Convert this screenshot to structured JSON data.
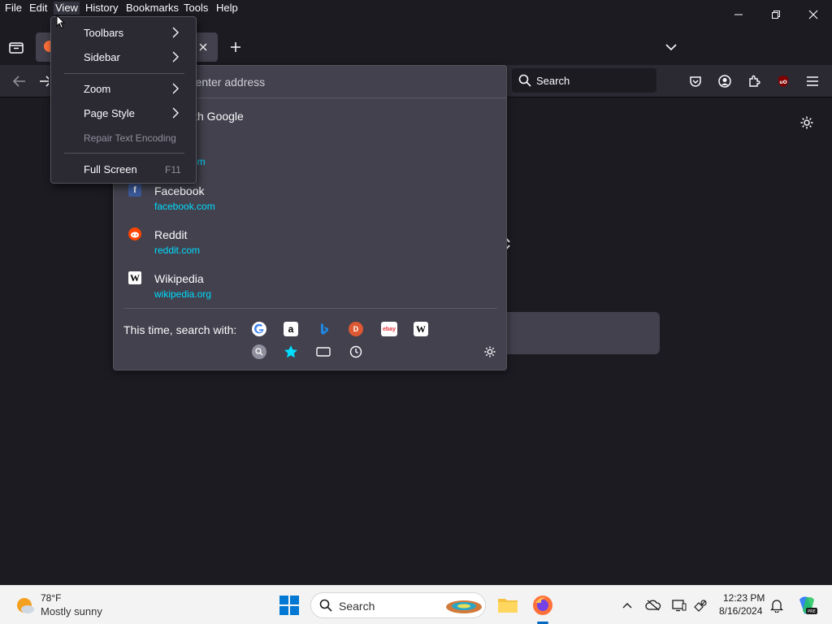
{
  "menubar": {
    "items": [
      "File",
      "Edit",
      "View",
      "History",
      "Bookmarks",
      "Tools",
      "Help"
    ]
  },
  "navbar": {
    "search_placeholder": "Search"
  },
  "urlbar": {
    "placeholder": "r enter address",
    "search_with_text": "ith Google",
    "partial_url": "om",
    "results": [
      {
        "title": "Facebook",
        "url": "facebook.com",
        "icon": "facebook-icon"
      },
      {
        "title": "Reddit",
        "url": "reddit.com",
        "icon": "reddit-icon"
      },
      {
        "title": "Wikipedia",
        "url": "wikipedia.org",
        "icon": "wikipedia-icon"
      }
    ],
    "oneoff_label": "This time, search with:",
    "oneoff_engines": [
      "google-icon",
      "amazon-icon",
      "bing-icon",
      "duckduckgo-icon",
      "ebay-icon",
      "wikipedia-icon"
    ],
    "oneoff_modes": [
      "search-history-icon",
      "bookmarks-star-icon",
      "tabs-icon",
      "history-clock-icon"
    ]
  },
  "view_menu": {
    "items": [
      {
        "label": "Toolbars",
        "submenu": true
      },
      {
        "label": "Sidebar",
        "submenu": true
      },
      {
        "label": "Zoom",
        "submenu": true
      },
      {
        "label": "Page Style",
        "submenu": true
      },
      {
        "label": "Repair Text Encoding",
        "disabled": true
      },
      {
        "label": "Full Screen",
        "shortcut": "F11"
      }
    ]
  },
  "taskbar": {
    "weather_temp": "78°F",
    "weather_desc": "Mostly sunny",
    "search_placeholder": "Search",
    "time": "12:23 PM",
    "date": "8/16/2024"
  },
  "colors": {
    "accent": "#00ddff",
    "panel": "#42414d",
    "menu": "#2b2a33",
    "bg": "#1c1b22"
  }
}
